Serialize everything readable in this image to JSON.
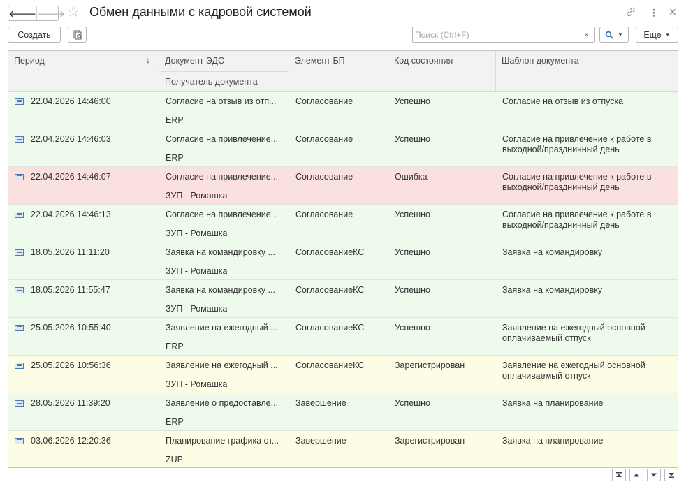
{
  "window": {
    "title": "Обмен данными с кадровой системой"
  },
  "toolbar": {
    "create_label": "Создать",
    "search_placeholder": "Поиск (Ctrl+F)",
    "clear_label": "×",
    "find_label": "🔍 ▾",
    "more_label": "Еще ▾"
  },
  "columns": {
    "period": "Период",
    "sort_indicator": "↓",
    "document": "Документ ЭДО",
    "recipient": "Получатель документа",
    "element": "Элемент БП",
    "status_code": "Код состояния",
    "template": "Шаблон документа"
  },
  "rows": [
    {
      "period": "22.04.2026 14:46:00",
      "document": "Согласие на отзыв из отп...",
      "recipient": "ERP",
      "element": "Согласование",
      "status": "Успешно",
      "template": "Согласие на отзыв из отпуска",
      "color": "green"
    },
    {
      "period": "22.04.2026 14:46:03",
      "document": "Согласие на привлечение...",
      "recipient": "ERP",
      "element": "Согласование",
      "status": "Успешно",
      "template": "Согласие на привлечение к работе в выходной/праздничный день",
      "color": "green"
    },
    {
      "period": "22.04.2026 14:46:07",
      "document": "Согласие на привлечение...",
      "recipient": "ЗУП - Ромашка",
      "element": "Согласование",
      "status": "Ошибка",
      "template": "Согласие на привлечение к работе в выходной/праздничный день",
      "color": "red"
    },
    {
      "period": "22.04.2026 14:46:13",
      "document": "Согласие на привлечение...",
      "recipient": "ЗУП - Ромашка",
      "element": "Согласование",
      "status": "Успешно",
      "template": "Согласие на привлечение к работе в выходной/праздничный день",
      "color": "green"
    },
    {
      "period": "18.05.2026 11:11:20",
      "document": "Заявка на командировку ...",
      "recipient": "ЗУП - Ромашка",
      "element": "СогласованиеКС",
      "status": "Успешно",
      "template": "Заявка на командировку",
      "color": "green"
    },
    {
      "period": "18.05.2026 11:55:47",
      "document": "Заявка на командировку ...",
      "recipient": "ЗУП - Ромашка",
      "element": "СогласованиеКС",
      "status": "Успешно",
      "template": "Заявка на командировку",
      "color": "green"
    },
    {
      "period": "25.05.2026 10:55:40",
      "document": "Заявление на ежегодный ...",
      "recipient": "ERP",
      "element": "СогласованиеКС",
      "status": "Успешно",
      "template": "Заявление на ежегодный основной оплачиваемый отпуск",
      "color": "green"
    },
    {
      "period": "25.05.2026 10:56:36",
      "document": "Заявление на ежегодный ...",
      "recipient": "ЗУП - Ромашка",
      "element": "СогласованиеКС",
      "status": "Зарегистрирован",
      "template": "Заявление на ежегодный основной оплачиваемый отпуск",
      "color": "yellow"
    },
    {
      "period": "28.05.2026 11:39:20",
      "document": "Заявление о предоставле...",
      "recipient": "ERP",
      "element": "Завершение",
      "status": "Успешно",
      "template": "Заявка на планирование",
      "color": "green"
    },
    {
      "period": "03.06.2026 12:20:36",
      "document": "Планирование графика от...",
      "recipient": "ZUP",
      "element": "Завершение",
      "status": "Зарегистрирован",
      "template": "Заявка на планирование",
      "color": "yellow"
    }
  ],
  "pager": {
    "first": "⏫",
    "up": "▲",
    "down": "▼",
    "last": "⏬"
  },
  "colors": {
    "success_row": "#eefaec",
    "error_row": "#fbe0e0",
    "registered_row": "#fdfde6"
  }
}
